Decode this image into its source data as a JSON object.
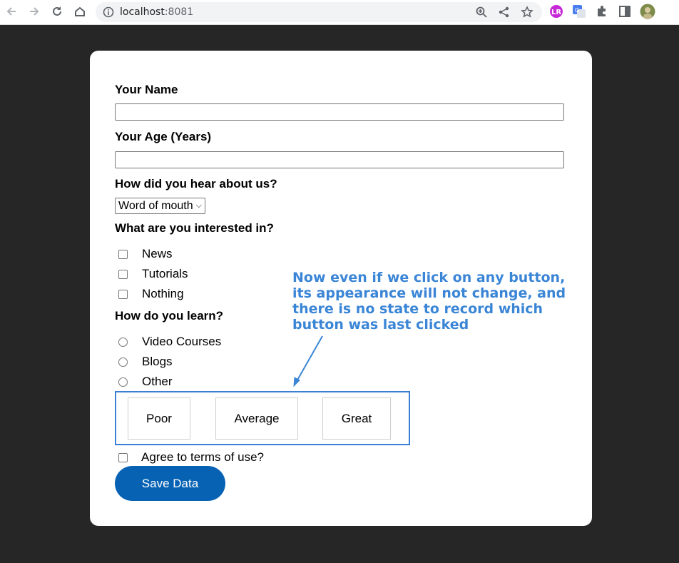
{
  "browser": {
    "url_host": "localhost",
    "url_port": ":8081"
  },
  "form": {
    "name_label": "Your Name",
    "name_value": "",
    "age_label": "Your Age (Years)",
    "age_value": "",
    "hear_label": "How did you hear about us?",
    "hear_selected": "Word of mouth",
    "interests_label": "What are you interested in?",
    "interests": [
      "News",
      "Tutorials",
      "Nothing"
    ],
    "learn_label": "How do you learn?",
    "learn_options": [
      "Video Courses",
      "Blogs",
      "Other"
    ],
    "rating_buttons": [
      "Poor",
      "Average",
      "Great"
    ],
    "terms_label": "Agree to terms of use?",
    "save_label": "Save Data"
  },
  "annotation": {
    "line1": "Now even if we click on any button,",
    "line2": "its appearance will not change, and",
    "line3": "there is no state to record which",
    "line4": "button was last clicked"
  },
  "colors": {
    "page_bg": "#262626",
    "accent": "#0762b4",
    "annotation": "#3a85d6"
  }
}
